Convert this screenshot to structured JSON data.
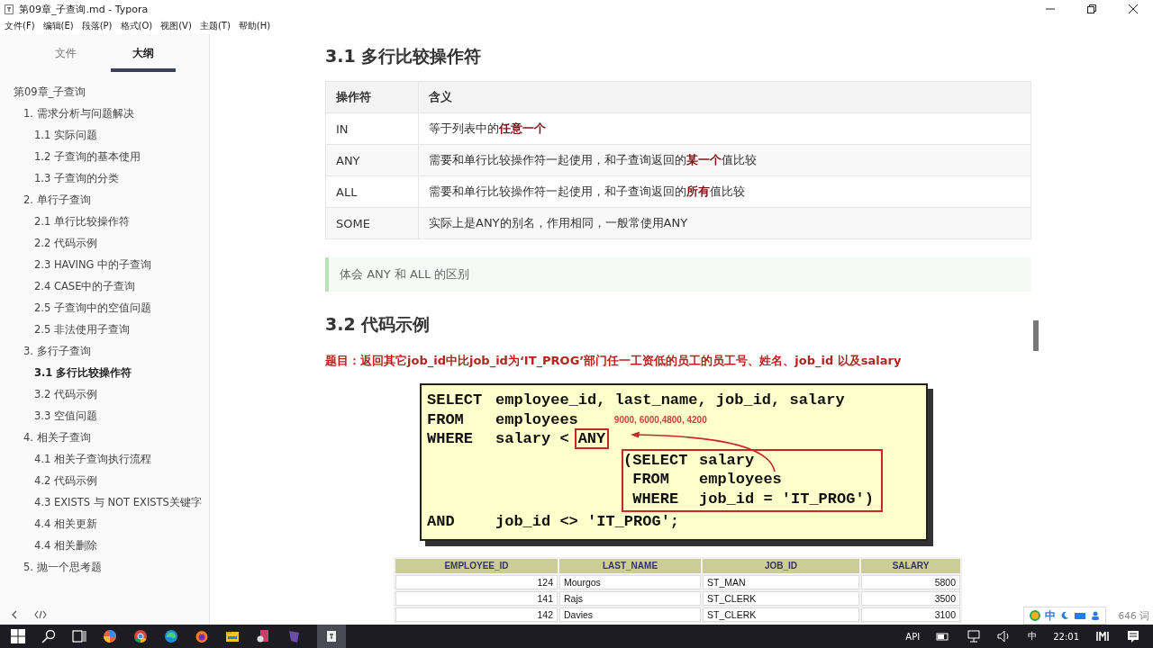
{
  "window": {
    "title": "第09章_子查询.md - Typora"
  },
  "menu": [
    "文件(F)",
    "编辑(E)",
    "段落(P)",
    "格式(O)",
    "视图(V)",
    "主题(T)",
    "帮助(H)"
  ],
  "sidebar": {
    "tabs": [
      {
        "label": "文件",
        "selected": false
      },
      {
        "label": "大纲",
        "selected": true
      }
    ],
    "outline": [
      {
        "label": "第09章_子查询",
        "selected": false,
        "children": [
          {
            "label": "1. 需求分析与问题解决",
            "selected": false,
            "children": [
              {
                "label": "1.1 实际问题",
                "selected": false
              },
              {
                "label": "1.2 子查询的基本使用",
                "selected": false
              },
              {
                "label": "1.3 子查询的分类",
                "selected": false
              }
            ]
          },
          {
            "label": "2. 单行子查询",
            "selected": false,
            "children": [
              {
                "label": "2.1 单行比较操作符",
                "selected": false
              },
              {
                "label": "2.2 代码示例",
                "selected": false
              },
              {
                "label": "2.3 HAVING 中的子查询",
                "selected": false
              },
              {
                "label": "2.4 CASE中的子查询",
                "selected": false
              },
              {
                "label": "2.5 子查询中的空值问题",
                "selected": false
              },
              {
                "label": "2.5 非法使用子查询",
                "selected": false
              }
            ]
          },
          {
            "label": "3. 多行子查询",
            "selected": false,
            "children": [
              {
                "label": "3.1 多行比较操作符",
                "selected": true
              },
              {
                "label": "3.2 代码示例",
                "selected": false
              },
              {
                "label": "3.3 空值问题",
                "selected": false
              }
            ]
          },
          {
            "label": "4. 相关子查询",
            "selected": false,
            "children": [
              {
                "label": "4.1 相关子查询执行流程",
                "selected": false
              },
              {
                "label": "4.2 代码示例",
                "selected": false
              },
              {
                "label": "4.3 EXISTS 与 NOT EXISTS关键字",
                "selected": false
              },
              {
                "label": "4.4 相关更新",
                "selected": false
              },
              {
                "label": "4.4 相关删除",
                "selected": false
              }
            ]
          },
          {
            "label": "5. 抛一个思考题",
            "selected": false
          }
        ]
      }
    ]
  },
  "content": {
    "heading_1": "3.1 多行比较操作符",
    "operator_table": {
      "columns": [
        "操作符",
        "含义"
      ],
      "rows": [
        [
          "IN",
          "等于列表中的**任意一个**"
        ],
        [
          "ANY",
          "需要和单行比较操作符一起使用，和子查询返回的**某一个**值比较"
        ],
        [
          "ALL",
          "需要和单行比较操作符一起使用，和子查询返回的**所有**值比较"
        ],
        [
          "SOME",
          "实际上是ANY的别名，作用相同，一般常使用ANY"
        ]
      ]
    },
    "quote": "体会 ANY 和 ALL 的区别",
    "heading_2": "3.2 代码示例",
    "problem": "题目：返回其它job_id中比job_id为‘IT_PROG’部门任一工资低的员工的员工号、姓名、job_id 以及salary",
    "code": {
      "head": [
        [
          "SELECT",
          "employee_id, last_name, job_id, salary"
        ],
        [
          "FROM",
          "employees"
        ]
      ],
      "note": "9000, 6000,4800, 4200",
      "compare": {
        "keyword": "WHERE",
        "text": "salary <",
        "boxed": "ANY"
      },
      "subquery": [
        [
          "(SELECT",
          "salary"
        ],
        [
          " FROM",
          "employees"
        ],
        [
          " WHERE",
          "job_id = 'IT_PROG')"
        ]
      ],
      "tail": [
        "AND",
        "job_id <> 'IT_PROG';"
      ]
    },
    "result_table": {
      "columns": [
        "EMPLOYEE_ID",
        "LAST_NAME",
        "JOB_ID",
        "SALARY"
      ],
      "rows": [
        [
          "124",
          "Mourgos",
          "ST_MAN",
          "5800"
        ],
        [
          "141",
          "Rajs",
          "ST_CLERK",
          "3500"
        ],
        [
          "142",
          "Davies",
          "ST_CLERK",
          "3100"
        ]
      ]
    }
  },
  "ime_bar": {
    "mode": "中",
    "word_count": "646 词"
  },
  "tray": {
    "api": "API",
    "input": "中",
    "time": "22:01"
  }
}
